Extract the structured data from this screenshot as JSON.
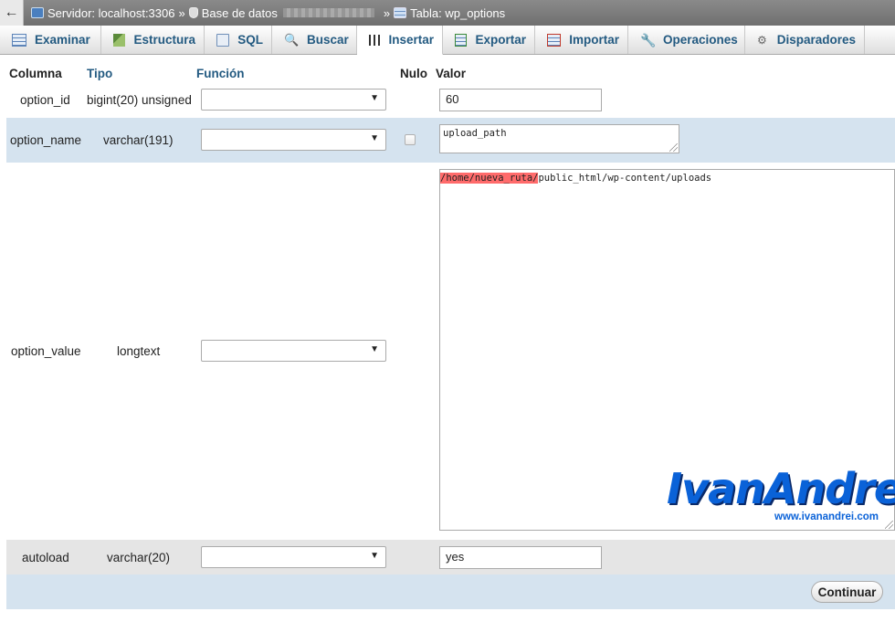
{
  "breadcrumb": {
    "server": "Servidor: localhost:3306",
    "database": "Base de datos",
    "table": "Tabla: wp_options"
  },
  "tabs": [
    {
      "label": "Examinar",
      "icon": "browse-icon"
    },
    {
      "label": "Estructura",
      "icon": "structure-icon"
    },
    {
      "label": "SQL",
      "icon": "sql-icon"
    },
    {
      "label": "Buscar",
      "icon": "search-icon"
    },
    {
      "label": "Insertar",
      "icon": "insert-icon"
    },
    {
      "label": "Exportar",
      "icon": "export-icon"
    },
    {
      "label": "Importar",
      "icon": "import-icon"
    },
    {
      "label": "Operaciones",
      "icon": "wrench-icon"
    },
    {
      "label": "Disparadores",
      "icon": "triggers-icon"
    }
  ],
  "active_tab": "Insertar",
  "table_headers": {
    "column": "Columna",
    "type": "Tipo",
    "function": "Función",
    "null": "Nulo",
    "value": "Valor"
  },
  "rows": [
    {
      "column": "option_id",
      "type": "bigint(20) unsigned",
      "function": "",
      "value": "60"
    },
    {
      "column": "option_name",
      "type": "varchar(191)",
      "function": "",
      "null": false,
      "value": "upload_path"
    },
    {
      "column": "option_value",
      "type": "longtext",
      "function": "",
      "value_highlight": "/home/nueva_ruta/",
      "value_rest": "public_html/wp-content/uploads"
    },
    {
      "column": "autoload",
      "type": "varchar(20)",
      "function": "",
      "value": "yes"
    }
  ],
  "continue_label": "Continuar",
  "watermark": {
    "brand": "IvanAndrei",
    "url": "www.ivanandrei.com"
  },
  "colors": {
    "link": "#235a81",
    "row_alt": "#d5e3ef",
    "row_gray": "#e5e5e5",
    "highlight": "#ff6b6b",
    "watermark": "#0a62d8"
  }
}
